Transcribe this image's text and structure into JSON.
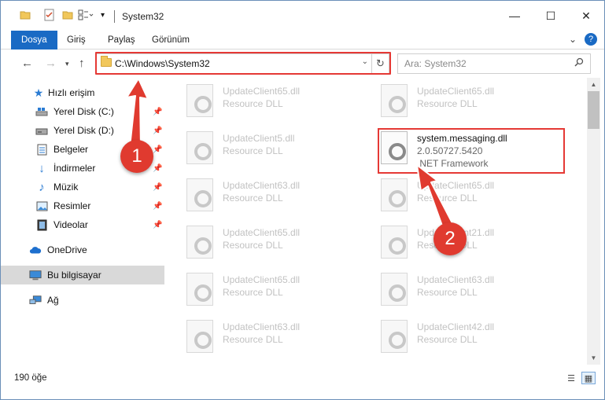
{
  "window": {
    "title": "System32"
  },
  "ribbon": {
    "tabs": [
      "Dosya",
      "Giriş",
      "Paylaş",
      "Görünüm"
    ]
  },
  "nav": {
    "address": "C:\\Windows\\System32",
    "search_placeholder": "Ara: System32"
  },
  "sidebar": {
    "items": [
      {
        "label": "Hızlı erişim",
        "icon": "star-icon"
      },
      {
        "label": "Yerel Disk (C:)",
        "icon": "drive-icon"
      },
      {
        "label": "Yerel Disk (D:)",
        "icon": "drive-icon"
      },
      {
        "label": "Belgeler",
        "icon": "documents-icon"
      },
      {
        "label": "İndirmeler",
        "icon": "download-icon"
      },
      {
        "label": "Müzik",
        "icon": "music-icon"
      },
      {
        "label": "Resimler",
        "icon": "pictures-icon"
      },
      {
        "label": "Videolar",
        "icon": "videos-icon"
      },
      {
        "label": "OneDrive",
        "icon": "cloud-icon"
      },
      {
        "label": "Bu bilgisayar",
        "icon": "computer-icon"
      },
      {
        "label": "Ağ",
        "icon": "network-icon"
      }
    ]
  },
  "files": {
    "left": [
      {
        "name": "UpdateClient65.dll",
        "desc": "Resource DLL"
      },
      {
        "name": "UpdateClient5.dll",
        "desc": "Resource DLL"
      },
      {
        "name": "UpdateClient63.dll",
        "desc": "Resource DLL"
      },
      {
        "name": "UpdateClient65.dll",
        "desc": "Resource DLL"
      },
      {
        "name": "UpdateClient65.dll",
        "desc": "Resource DLL"
      },
      {
        "name": "UpdateClient63.dll",
        "desc": "Resource DLL"
      }
    ],
    "right": [
      {
        "name": "UpdateClient65.dll",
        "desc": "Resource DLL"
      },
      {
        "name": "UpdateClient65.dll",
        "desc": "Resource DLL"
      },
      {
        "name": "UpdateClient21.dll",
        "desc": "Resource DLL"
      },
      {
        "name": "UpdateClient63.dll",
        "desc": "Resource DLL"
      },
      {
        "name": "UpdateClient42.dll",
        "desc": "Resource DLL"
      }
    ],
    "highlighted": {
      "name": "system.messaging.dll",
      "version": "2.0.50727.5420",
      "company": ".NET Framework"
    }
  },
  "status": {
    "count": "190 öğe"
  },
  "annotations": {
    "badge1": "1",
    "badge2": "2",
    "color": "#e03a2f"
  }
}
